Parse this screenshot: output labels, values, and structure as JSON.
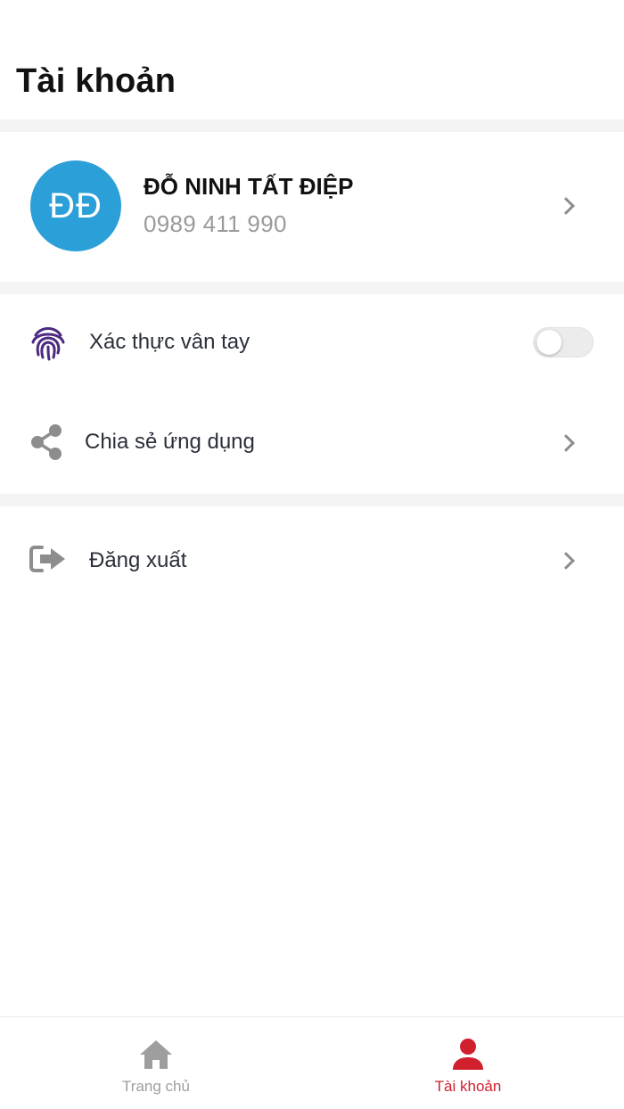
{
  "header": {
    "title": "Tài khoản"
  },
  "profile": {
    "initials": "ĐĐ",
    "name": "ĐỖ NINH TẤT ĐIỆP",
    "phone": "0989 411 990",
    "avatar_color": "#2b9fd8"
  },
  "settings": {
    "fingerprint": {
      "label": "Xác thực vân tay",
      "icon": "fingerprint-icon",
      "enabled": false,
      "icon_color": "#4b2a7f"
    },
    "share": {
      "label": "Chia sẻ ứng dụng",
      "icon": "share-icon"
    },
    "logout": {
      "label": "Đăng xuất",
      "icon": "logout-icon"
    }
  },
  "tabbar": {
    "home": {
      "label": "Trang chủ",
      "icon": "home-icon",
      "active": false
    },
    "account": {
      "label": "Tài khoản",
      "icon": "person-icon",
      "active": true
    }
  },
  "colors": {
    "accent": "#d0202e",
    "inactive": "#9e9e9e",
    "separator": "#f4f4f4"
  }
}
